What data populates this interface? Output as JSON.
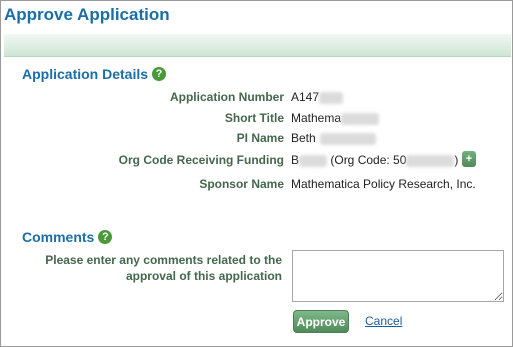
{
  "page": {
    "title": "Approve Application"
  },
  "details": {
    "heading": "Application Details",
    "help_glyph": "?",
    "fields": [
      {
        "label": "Application Number",
        "value": "A147"
      },
      {
        "label": "Short Title",
        "value": "Mathema"
      },
      {
        "label": "PI Name",
        "value": "Beth"
      },
      {
        "label": "Org Code Receiving Funding",
        "value_prefix": "B",
        "value_mid": "(Org Code: 50",
        "value_suffix": ")"
      },
      {
        "label": "Sponsor Name",
        "value": "Mathematica Policy Research, Inc."
      }
    ],
    "plus_glyph": "+"
  },
  "comments": {
    "heading": "Comments",
    "help_glyph": "?",
    "label": "Please enter any comments related to the approval of this application",
    "value": ""
  },
  "actions": {
    "approve_label": "Approve",
    "cancel_label": "Cancel"
  },
  "colors": {
    "title": "#1a6fa8",
    "label": "#44674d",
    "button": "#5a9a64",
    "help": "#4a9a3a"
  },
  "icons": {
    "help": "help-circle-icon",
    "plus": "plus-icon"
  }
}
